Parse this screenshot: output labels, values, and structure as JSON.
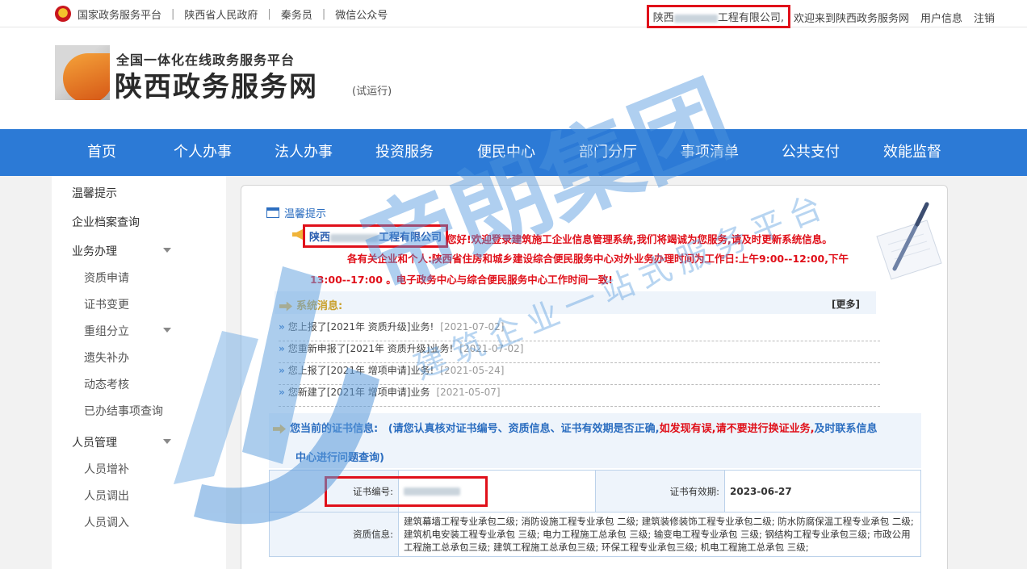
{
  "topbar": {
    "links": [
      "国家政务服务平台",
      "陕西省人民政府",
      "秦务员",
      "微信公众号"
    ],
    "separator": "|",
    "company_prefix": "陕西",
    "company_suffix": "工程有限公司,",
    "welcome": "欢迎来到陕西政务服务网",
    "user_info": "用户信息",
    "logout": "注销"
  },
  "header": {
    "subtitle": "全国一体化在线政务服务平台",
    "title": "陕西政务服务网",
    "trial": "(试运行)"
  },
  "nav": {
    "items": [
      "首页",
      "个人办事",
      "法人办事",
      "投资服务",
      "便民中心",
      "部门分厅",
      "事项清单",
      "公共支付",
      "效能监督"
    ]
  },
  "sidebar": {
    "tips": "温馨提示",
    "archive": "企业档案查询",
    "business": "业务办理",
    "business_items": [
      "资质申请",
      "证书变更",
      "重组分立",
      "遗失补办",
      "动态考核",
      "已办结事项查询"
    ],
    "personnel": "人员管理",
    "personnel_items": [
      "人员增补",
      "人员调出",
      "人员调入"
    ]
  },
  "main": {
    "tip_title": "温馨提示",
    "company_prefix": "陕西",
    "company_suffix": "工程有限公司",
    "greeting": "您好!欢迎登录建筑施工企业信息管理系统,我们将竭诚为您服务,请及时更新系统信息。",
    "notice_1": "各有关企业和个人:陕西省住房和城乡建设综合便民服务中心对外业务办理时间为工作日:上午9:00--12:00,下午",
    "notice_2": "13:00--17:00 。电子政务中心与综合便民服务中心工作时间一致!",
    "system_msg_title": "系统消息:",
    "more": "[更多]",
    "messages": [
      {
        "text": "您上报了[2021年 资质升级]业务!",
        "date": "[2021-07-02]"
      },
      {
        "text": "您重新申报了[2021年 资质升级]业务!",
        "date": "[2021-07-02]"
      },
      {
        "text": "您上报了[2021年 增项申请]业务!",
        "date": "[2021-05-24]"
      },
      {
        "text": "您新建了[2021年 增项申请]业务",
        "date": "[2021-05-07]"
      }
    ],
    "cert_title": "您当前的证书信息:",
    "cert_note_1": "(请您认真核对证书编号、资质信息、证书有效期是否正确,",
    "cert_note_2": "如发现有误,请不要进行换证业务,",
    "cert_note_3": "及时联系信息",
    "cert_note_4": "中心进行问题查询)",
    "cert_no_label": "证书编号:",
    "cert_validity_label": "证书有效期:",
    "cert_validity": "2023-06-27",
    "qual_label": "资质信息:",
    "qual_text": "建筑幕墙工程专业承包二级; 消防设施工程专业承包 二级; 建筑装修装饰工程专业承包二级; 防水防腐保温工程专业承包 二级; 建筑机电安装工程专业承包 三级; 电力工程施工总承包 三级; 输变电工程专业承包 三级; 钢结构工程专业承包三级; 市政公用工程施工总承包三级; 建筑工程施工总承包三级; 环保工程专业承包三级; 机电工程施工总承包 三级;"
  },
  "watermark": {
    "brand": "帝朗集团",
    "slogan": "建筑企业一站式服务平台"
  },
  "colors": {
    "nav_bg": "#2c7ad6",
    "highlight_red": "#e0101a",
    "link_blue": "#2c6ec0"
  }
}
